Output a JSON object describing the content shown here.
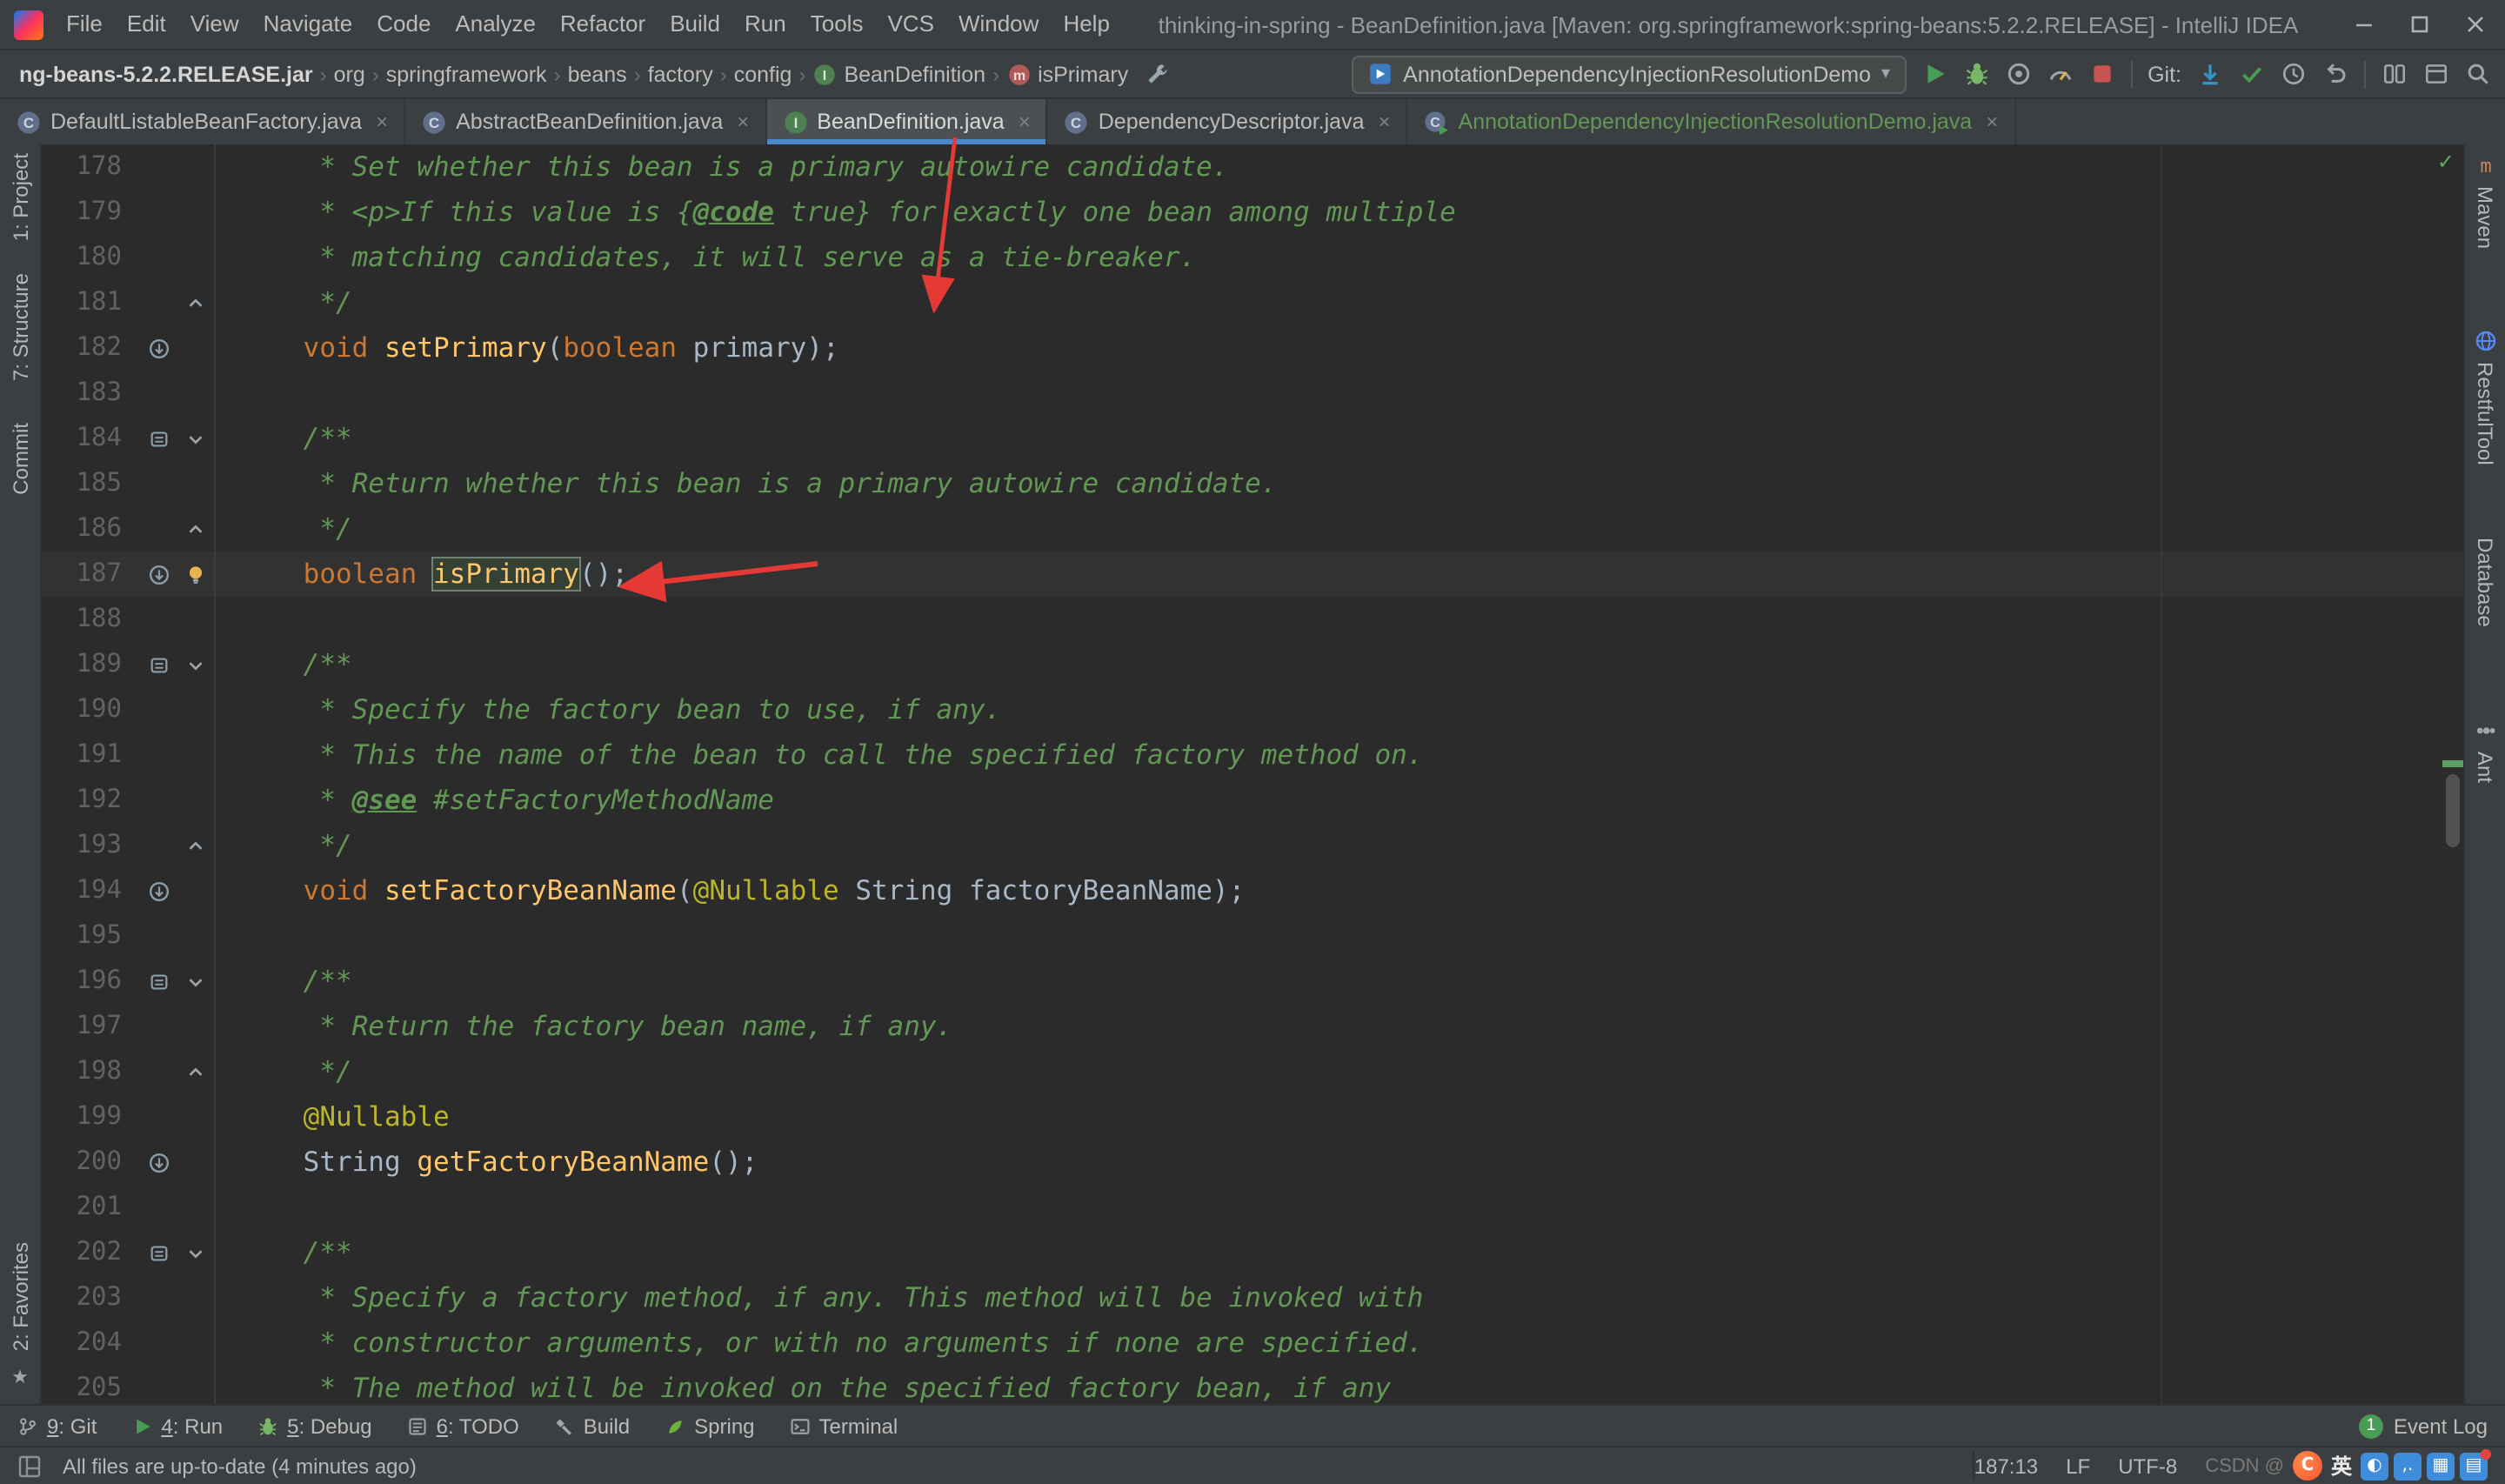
{
  "window": {
    "title": "thinking-in-spring - BeanDefinition.java [Maven: org.springframework:spring-beans:5.2.2.RELEASE] - IntelliJ IDEA",
    "menu_items": [
      "File",
      "Edit",
      "View",
      "Navigate",
      "Code",
      "Analyze",
      "Refactor",
      "Build",
      "Run",
      "Tools",
      "VCS",
      "Window",
      "Help"
    ]
  },
  "navbar": {
    "breadcrumbs": [
      "ng-beans-5.2.2.RELEASE.jar",
      "org",
      "springframework",
      "beans",
      "factory",
      "config"
    ],
    "class_crumb": "BeanDefinition",
    "method_crumb": "isPrimary",
    "run_configuration": "AnnotationDependencyInjectionResolutionDemo",
    "git_label": "Git:"
  },
  "tabs": [
    {
      "label": "DefaultListableBeanFactory.java",
      "icon": "classicon",
      "state": "normal"
    },
    {
      "label": "AbstractBeanDefinition.java",
      "icon": "classicon",
      "state": "normal"
    },
    {
      "label": "BeanDefinition.java",
      "icon": "interfaceicon",
      "state": "active"
    },
    {
      "label": "DependencyDescriptor.java",
      "icon": "classicon",
      "state": "normal"
    },
    {
      "label": "AnnotationDependencyInjectionResolutionDemo.java",
      "icon": "runnableicon",
      "state": "green"
    }
  ],
  "left_stripe": {
    "top": [
      "1: Project",
      "7: Structure",
      "Commit"
    ],
    "bottom": [
      "2: Favorites"
    ]
  },
  "right_stripe": {
    "items": [
      {
        "label": "Maven",
        "icon": "maven"
      },
      {
        "label": "RestfulTool",
        "icon": "globe"
      },
      {
        "label": "Database",
        "icon": null
      },
      {
        "label": "Ant",
        "icon": "ant"
      }
    ]
  },
  "editor": {
    "lines": [
      {
        "n": "178",
        "segs": [
          [
            "cm",
            "     * Set whether this bean is a primary autowire candidate."
          ]
        ]
      },
      {
        "n": "179",
        "segs": [
          [
            "cm",
            "     * <p>If this value is {"
          ],
          [
            "tag",
            "@code"
          ],
          [
            "cm",
            " true} for exactly one bean among multiple"
          ]
        ]
      },
      {
        "n": "180",
        "segs": [
          [
            "cm",
            "     * matching candidates, it will serve as a tie-breaker."
          ]
        ]
      },
      {
        "n": "181",
        "f": "up",
        "segs": [
          [
            "cm",
            "     */"
          ]
        ]
      },
      {
        "n": "182",
        "g": "impl",
        "segs": [
          [
            "pl",
            "    "
          ],
          [
            "kw",
            "void"
          ],
          [
            "pl",
            " "
          ],
          [
            "fn",
            "setPrimary"
          ],
          [
            "pl",
            "("
          ],
          [
            "kw",
            "boolean"
          ],
          [
            "pl",
            " primary);"
          ]
        ]
      },
      {
        "n": "183",
        "segs": []
      },
      {
        "n": "184",
        "g": "doc",
        "f": "down",
        "segs": [
          [
            "cm",
            "    /**"
          ]
        ]
      },
      {
        "n": "185",
        "segs": [
          [
            "cm",
            "     * Return whether this bean is a primary autowire candidate."
          ]
        ]
      },
      {
        "n": "186",
        "f": "up",
        "segs": [
          [
            "cm",
            "     */"
          ]
        ]
      },
      {
        "n": "187",
        "g": "impl",
        "bulb": true,
        "hl": true,
        "segs": [
          [
            "pl",
            "    "
          ],
          [
            "kw",
            "boolean"
          ],
          [
            "pl",
            " "
          ],
          [
            "caret",
            ""
          ],
          [
            "fnbox",
            "isPrimary"
          ],
          [
            "pl",
            "();"
          ]
        ]
      },
      {
        "n": "188",
        "segs": []
      },
      {
        "n": "189",
        "g": "doc",
        "f": "down",
        "segs": [
          [
            "cm",
            "    /**"
          ]
        ]
      },
      {
        "n": "190",
        "segs": [
          [
            "cm",
            "     * Specify the factory bean to use, if any."
          ]
        ]
      },
      {
        "n": "191",
        "segs": [
          [
            "cm",
            "     * This the name of the bean to call the specified factory method on."
          ]
        ]
      },
      {
        "n": "192",
        "segs": [
          [
            "cm",
            "     * "
          ],
          [
            "tag",
            "@see"
          ],
          [
            "cm",
            " #setFactoryMethodName"
          ]
        ]
      },
      {
        "n": "193",
        "f": "up",
        "segs": [
          [
            "cm",
            "     */"
          ]
        ]
      },
      {
        "n": "194",
        "g": "impl",
        "segs": [
          [
            "pl",
            "    "
          ],
          [
            "kw",
            "void"
          ],
          [
            "pl",
            " "
          ],
          [
            "fn",
            "setFactoryBeanName"
          ],
          [
            "pl",
            "("
          ],
          [
            "ann",
            "@Nullable"
          ],
          [
            "pl",
            " String factoryBeanName);"
          ]
        ]
      },
      {
        "n": "195",
        "segs": []
      },
      {
        "n": "196",
        "g": "doc",
        "f": "down",
        "segs": [
          [
            "cm",
            "    /**"
          ]
        ]
      },
      {
        "n": "197",
        "segs": [
          [
            "cm",
            "     * Return the factory bean name, if any."
          ]
        ]
      },
      {
        "n": "198",
        "f": "up",
        "segs": [
          [
            "cm",
            "     */"
          ]
        ]
      },
      {
        "n": "199",
        "segs": [
          [
            "pl",
            "    "
          ],
          [
            "ann",
            "@Nullable"
          ]
        ]
      },
      {
        "n": "200",
        "g": "impl",
        "segs": [
          [
            "pl",
            "    String "
          ],
          [
            "fn",
            "getFactoryBeanName"
          ],
          [
            "pl",
            "();"
          ]
        ]
      },
      {
        "n": "201",
        "segs": []
      },
      {
        "n": "202",
        "g": "doc",
        "f": "down",
        "segs": [
          [
            "cm",
            "    /**"
          ]
        ]
      },
      {
        "n": "203",
        "segs": [
          [
            "cm",
            "     * Specify a factory method, if any. This method will be invoked with"
          ]
        ]
      },
      {
        "n": "204",
        "segs": [
          [
            "cm",
            "     * constructor arguments, or with no arguments if none are specified."
          ]
        ]
      },
      {
        "n": "205",
        "segs": [
          [
            "cm",
            "     * The method will be invoked on the specified factory bean, if any"
          ]
        ]
      }
    ]
  },
  "bottom_bar": {
    "items": [
      {
        "key": "9",
        "label": "Git",
        "icon": "gitbranch"
      },
      {
        "key": "4",
        "label": "Run",
        "icon": "play"
      },
      {
        "key": "5",
        "label": "Debug",
        "icon": "bug"
      },
      {
        "key": "6",
        "label": "TODO",
        "icon": "todo"
      },
      {
        "key": "",
        "label": "Build",
        "icon": "build"
      },
      {
        "key": "",
        "label": "Spring",
        "icon": "spring"
      },
      {
        "key": "",
        "label": "Terminal",
        "icon": "terminal"
      }
    ],
    "event_log": {
      "badge": "1",
      "label": "Event Log"
    }
  },
  "status_bar": {
    "message": "All files are up-to-date (4 minutes ago)",
    "caret_position": "187:13",
    "line_ending": "LF",
    "encoding": "UTF-8",
    "watermark_text": "CSDN @"
  },
  "glyphs": {
    "crumb_separator": "›",
    "dropdown_arrow": "▾",
    "tab_close": "×",
    "inspections_ok": "✓",
    "favorites_star": "★",
    "watermark_lang": "英",
    "ime_moon": "◐",
    "ime_punct": ",.",
    "ime_keyboard": "▦",
    "ime_board": "▤"
  }
}
